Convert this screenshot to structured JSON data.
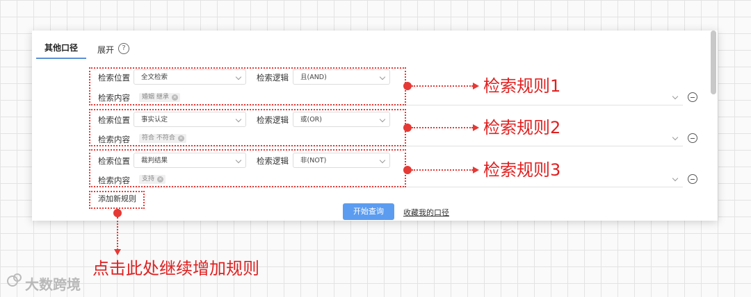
{
  "panel": {
    "tab_label": "其他口径",
    "expand_label": "展开",
    "help_icon": "?",
    "rules": [
      {
        "position_label": "检索位置",
        "position_value": "全文检索",
        "logic_label": "检索逻辑",
        "logic_value": "且(AND)",
        "content_label": "检索内容",
        "tag": "婚姻 继承"
      },
      {
        "position_label": "检索位置",
        "position_value": "事实认定",
        "logic_label": "检索逻辑",
        "logic_value": "或(OR)",
        "content_label": "检索内容",
        "tag": "符合 不符合"
      },
      {
        "position_label": "检索位置",
        "position_value": "裁判结果",
        "logic_label": "检索逻辑",
        "logic_value": "非(NOT)",
        "content_label": "检索内容",
        "tag": "支持"
      }
    ],
    "add_rule": "添加新规则",
    "start_search": "开始查询",
    "favorite": "收藏我的口径"
  },
  "annotations": {
    "rule1": "检索规则1",
    "rule2": "检索规则2",
    "rule3": "检索规则3",
    "add_hint": "点击此处继续增加规则"
  },
  "watermark": "大数跨境",
  "colors": {
    "annotation": "#e53935",
    "primary_button": "#5b9cf0",
    "tab_underline": "#5b8fd6"
  }
}
